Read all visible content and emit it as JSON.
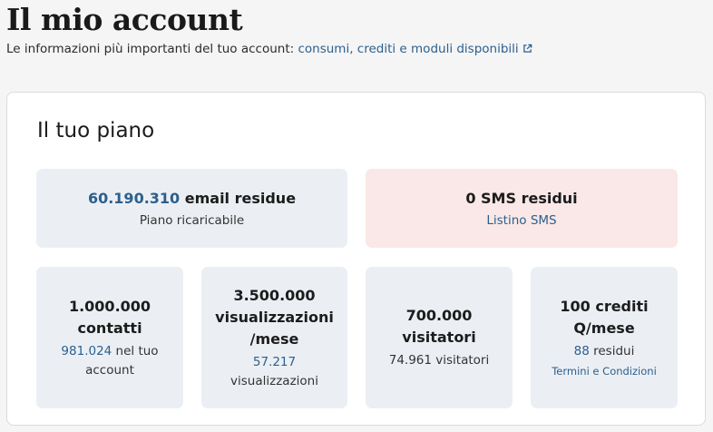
{
  "header": {
    "title": "Il mio account",
    "subtitle_text": "Le informazioni più importanti del tuo account: ",
    "subtitle_link": "consumi, crediti e moduli disponibili"
  },
  "plan": {
    "title": "Il tuo piano",
    "email": {
      "value": "60.190.310",
      "label": " email residue",
      "sub": "Piano ricaricabile"
    },
    "sms": {
      "title": "0 SMS residui",
      "link": "Listino SMS"
    },
    "contacts": {
      "line1": "1.000.000",
      "line2": "contatti",
      "used": "981.024",
      "used_suffix": " nel tuo",
      "used_line2": "account"
    },
    "views": {
      "line1": "3.500.000",
      "line2": "visualizzazioni",
      "line3": "/mese",
      "used": "57.217",
      "used_line2": "visualizzazioni"
    },
    "visitors": {
      "line1": "700.000",
      "line2": "visitatori",
      "sub": "74.961 visitatori"
    },
    "credits": {
      "line1": "100 crediti",
      "line2": "Q/mese",
      "used": "88",
      "used_suffix": " residui",
      "link": "Termini e Condizioni"
    }
  },
  "colors": {
    "accent": "#2c5f8d",
    "tile_bg": "#ebeff4",
    "alert_bg": "#f9e8e7"
  }
}
